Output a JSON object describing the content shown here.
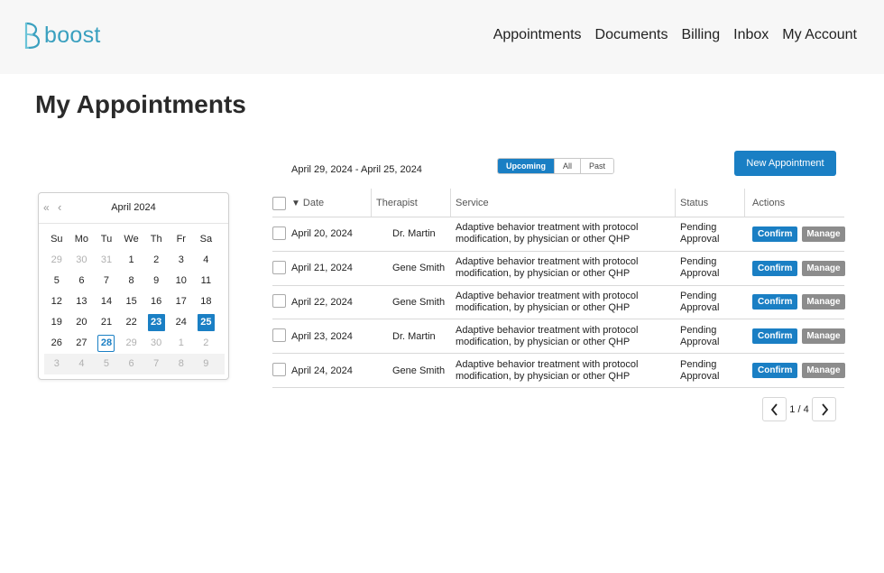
{
  "brand": {
    "name": "boost",
    "color": "#3aa0bf"
  },
  "nav": [
    "Appointments",
    "Documents",
    "Billing",
    "Inbox",
    "My Account"
  ],
  "page_title": "My Appointments",
  "calendar": {
    "month_label": "April 2024",
    "prev_year_icon": "double-chevron-left-icon",
    "prev_month_icon": "chevron-left-icon",
    "weekdays": [
      "Su",
      "Mo",
      "Tu",
      "We",
      "Th",
      "Fr",
      "Sa"
    ],
    "weeks": [
      [
        {
          "d": "29",
          "m": true
        },
        {
          "d": "30",
          "m": true
        },
        {
          "d": "31",
          "m": true
        },
        {
          "d": "1"
        },
        {
          "d": "2"
        },
        {
          "d": "3"
        },
        {
          "d": "4"
        }
      ],
      [
        {
          "d": "5"
        },
        {
          "d": "6"
        },
        {
          "d": "7"
        },
        {
          "d": "8"
        },
        {
          "d": "9"
        },
        {
          "d": "10"
        },
        {
          "d": "11"
        }
      ],
      [
        {
          "d": "12"
        },
        {
          "d": "13"
        },
        {
          "d": "14"
        },
        {
          "d": "15"
        },
        {
          "d": "16"
        },
        {
          "d": "17"
        },
        {
          "d": "18"
        }
      ],
      [
        {
          "d": "19"
        },
        {
          "d": "20"
        },
        {
          "d": "21"
        },
        {
          "d": "22"
        },
        {
          "d": "23",
          "s": true
        },
        {
          "d": "24"
        },
        {
          "d": "25",
          "s": true
        }
      ],
      [
        {
          "d": "26"
        },
        {
          "d": "27"
        },
        {
          "d": "28",
          "t": true
        },
        {
          "d": "29",
          "m": true
        },
        {
          "d": "30",
          "m": true
        },
        {
          "d": "1",
          "m": true
        },
        {
          "d": "2",
          "m": true
        }
      ],
      [
        {
          "d": "3",
          "m": true
        },
        {
          "d": "4",
          "m": true
        },
        {
          "d": "5",
          "m": true
        },
        {
          "d": "6",
          "m": true
        },
        {
          "d": "7",
          "m": true
        },
        {
          "d": "8",
          "m": true
        },
        {
          "d": "9",
          "m": true
        }
      ]
    ]
  },
  "date_range": "April 29, 2024 - April 25, 2024",
  "filter_tabs": [
    {
      "label": "Upcoming",
      "active": true
    },
    {
      "label": "All",
      "active": false
    },
    {
      "label": "Past",
      "active": false
    }
  ],
  "new_appointment_label": "New Appointment",
  "table": {
    "headers": {
      "date": "Date",
      "therapist": "Therapist",
      "service": "Service",
      "status": "Status",
      "actions": "Actions"
    },
    "rows": [
      {
        "date": "April 20, 2024",
        "therapist": "Dr. Martin",
        "service_line1": "Adaptive behavior treatment with protocol",
        "service_line2": "modification, by physician or other QHP",
        "status_line1": "Pending",
        "status_line2": "Approval",
        "confirm": "Confirm",
        "manage": "Manage"
      },
      {
        "date": "April 21, 2024",
        "therapist": "Gene Smith",
        "service_line1": "Adaptive behavior treatment with protocol",
        "service_line2": "modification, by physician or other QHP",
        "status_line1": "Pending",
        "status_line2": "Approval",
        "confirm": "Confirm",
        "manage": "Manage"
      },
      {
        "date": "April 22, 2024",
        "therapist": "Gene Smith",
        "service_line1": "Adaptive behavior treatment with protocol",
        "service_line2": "modification, by physician or other QHP",
        "status_line1": "Pending",
        "status_line2": "Approval",
        "confirm": "Confirm",
        "manage": "Manage"
      },
      {
        "date": "April 23, 2024",
        "therapist": "Dr. Martin",
        "service_line1": "Adaptive behavior treatment with protocol",
        "service_line2": "modification, by physician or other QHP",
        "status_line1": "Pending",
        "status_line2": "Approval",
        "confirm": "Confirm",
        "manage": "Manage"
      },
      {
        "date": "April 24, 2024",
        "therapist": "Gene Smith",
        "service_line1": "Adaptive behavior treatment with protocol",
        "service_line2": "modification, by physician or other QHP",
        "status_line1": "Pending",
        "status_line2": "Approval",
        "confirm": "Confirm",
        "manage": "Manage"
      }
    ]
  },
  "pagination": {
    "label": "1 / 4",
    "prev_icon": "chevron-left-icon",
    "next_icon": "chevron-right-icon"
  },
  "colors": {
    "primary": "#1a7fc4",
    "manage": "#8c8c8c"
  }
}
